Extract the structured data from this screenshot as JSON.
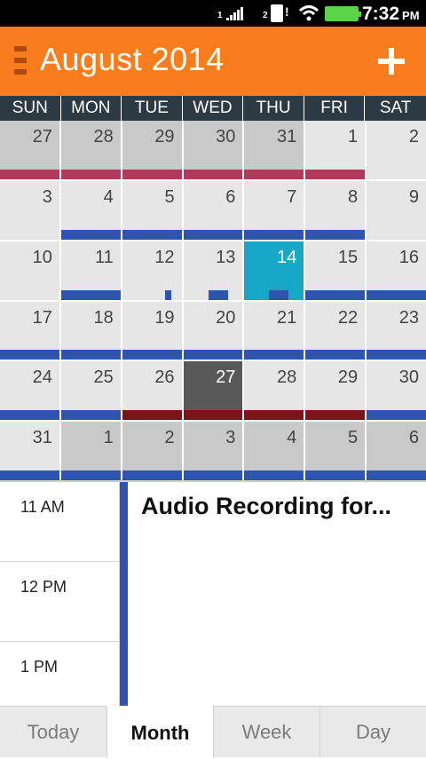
{
  "status_bar": {
    "sim1_label": "1",
    "sim2_label": "2",
    "time": "7:32",
    "ampm": "PM"
  },
  "header": {
    "title": "August 2014",
    "add_label": "+"
  },
  "weekdays": [
    "SUN",
    "MON",
    "TUE",
    "WED",
    "THU",
    "FRI",
    "SAT"
  ],
  "weeks": [
    [
      "27",
      "28",
      "29",
      "30",
      "31",
      "1",
      "2"
    ],
    [
      "3",
      "4",
      "5",
      "6",
      "7",
      "8",
      "9"
    ],
    [
      "10",
      "11",
      "12",
      "13",
      "14",
      "15",
      "16"
    ],
    [
      "17",
      "18",
      "19",
      "20",
      "21",
      "22",
      "23"
    ],
    [
      "24",
      "25",
      "26",
      "27",
      "28",
      "29",
      "30"
    ],
    [
      "31",
      "1",
      "2",
      "3",
      "4",
      "5",
      "6"
    ]
  ],
  "today_date": "14",
  "selected_date": "27",
  "agenda": {
    "hours": [
      "11 AM",
      "12 PM",
      "1 PM"
    ],
    "event_title": "Audio Recording for..."
  },
  "tabs": [
    "Today",
    "Month",
    "Week",
    "Day"
  ],
  "active_tab": "Month",
  "colors": {
    "header": "#f97d1d",
    "today": "#18a7c7",
    "event_blue": "#2e54b0",
    "event_pink": "#b03a5a",
    "event_red": "#7a1416"
  }
}
